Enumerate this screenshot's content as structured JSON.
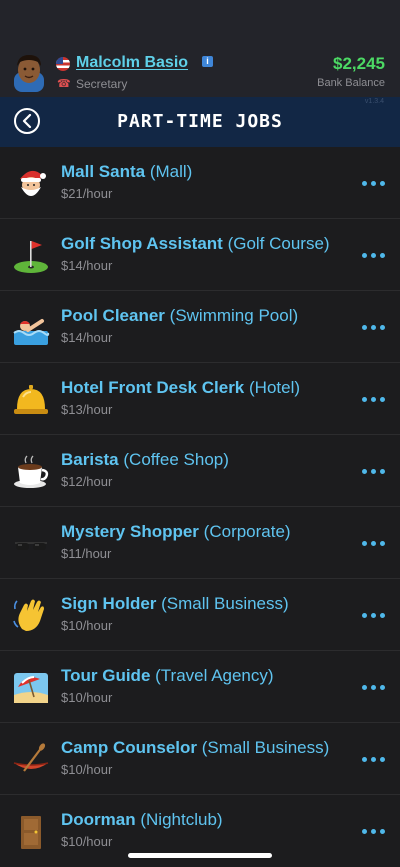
{
  "profile": {
    "name": "Malcolm Basio",
    "info_badge": "i",
    "role": "Secretary",
    "balance": "$2,245",
    "balance_label": "Bank Balance",
    "version": "v1.3.4"
  },
  "titlebar": {
    "title": "PART-TIME JOBS"
  },
  "jobs": [
    {
      "title": "Mall Santa",
      "location": "(Mall)",
      "pay": "$21/hour",
      "icon": "santa-icon"
    },
    {
      "title": "Golf Shop Assistant",
      "location": "(Golf Course)",
      "pay": "$14/hour",
      "icon": "golf-flag-icon"
    },
    {
      "title": "Pool Cleaner",
      "location": "(Swimming Pool)",
      "pay": "$14/hour",
      "icon": "swimmer-icon"
    },
    {
      "title": "Hotel Front Desk Clerk",
      "location": "(Hotel)",
      "pay": "$13/hour",
      "icon": "service-bell-icon"
    },
    {
      "title": "Barista",
      "location": "(Coffee Shop)",
      "pay": "$12/hour",
      "icon": "coffee-cup-icon"
    },
    {
      "title": "Mystery Shopper",
      "location": "(Corporate)",
      "pay": "$11/hour",
      "icon": "sunglasses-icon"
    },
    {
      "title": "Sign Holder",
      "location": "(Small Business)",
      "pay": "$10/hour",
      "icon": "waving-hand-icon"
    },
    {
      "title": "Tour Guide",
      "location": "(Travel Agency)",
      "pay": "$10/hour",
      "icon": "beach-umbrella-icon"
    },
    {
      "title": "Camp Counselor",
      "location": "(Small Business)",
      "pay": "$10/hour",
      "icon": "canoe-icon"
    },
    {
      "title": "Doorman",
      "location": "(Nightclub)",
      "pay": "$10/hour",
      "icon": "door-icon"
    }
  ],
  "colors": {
    "accent": "#5fc4f0",
    "balance": "#4cd964",
    "titlebar": "#122745",
    "background": "#1c1c1e"
  }
}
